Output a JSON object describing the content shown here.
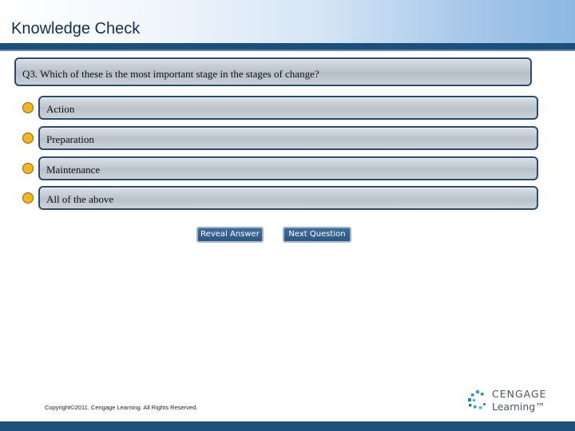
{
  "header": {
    "title": "Knowledge Check"
  },
  "question": {
    "text": "Q3. Which of these is the most important stage in the stages of change?"
  },
  "options": [
    {
      "label": "Action"
    },
    {
      "label": "Preparation"
    },
    {
      "label": "Maintenance"
    },
    {
      "label": "All of the above"
    }
  ],
  "buttons": {
    "reveal_label": "Reveal Answer",
    "next_label": "Next Question"
  },
  "footer": {
    "copyright": "Copyright©2011. Cengage Learning. All Rights Reserved."
  },
  "logo": {
    "line1": "CENGAGE",
    "line2": "Learning™"
  },
  "colors": {
    "header_bar": "#1d4f7c",
    "bullet": "#f4b61f",
    "button": "#2f6090"
  }
}
